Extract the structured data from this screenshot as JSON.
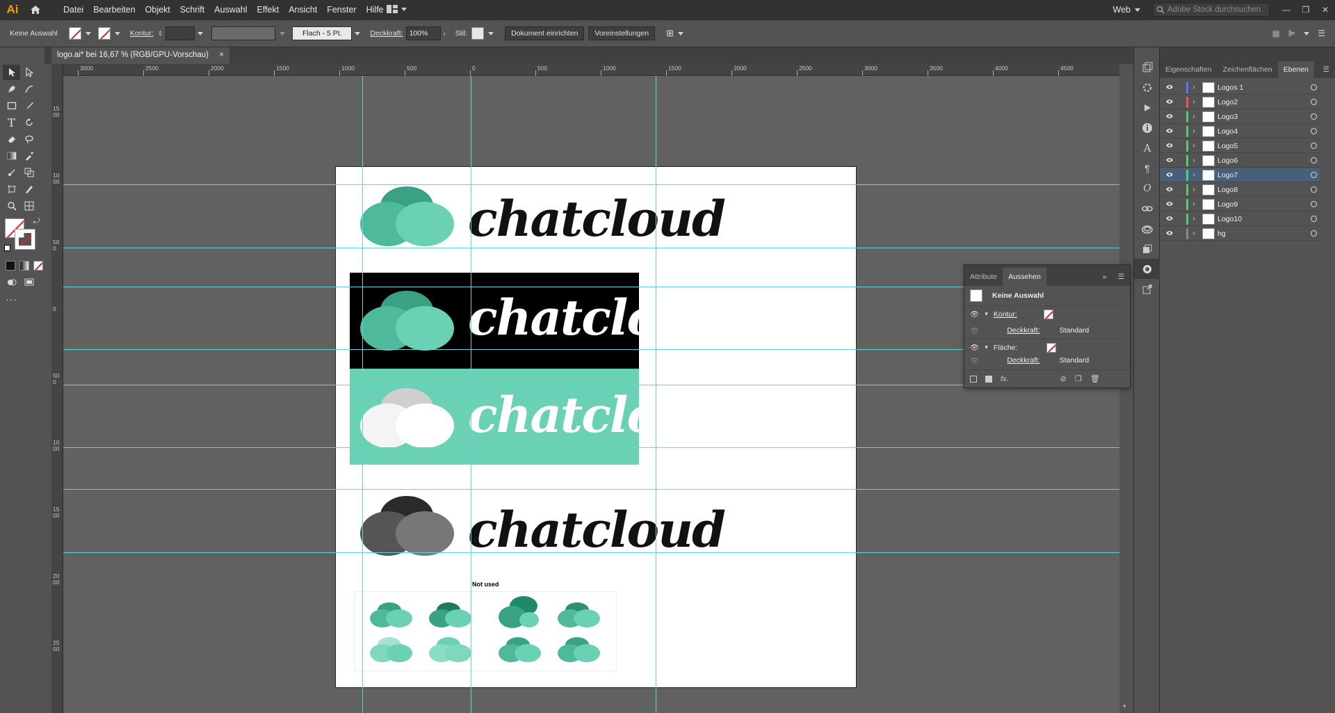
{
  "app": {
    "logo_text": "Ai"
  },
  "menu": [
    "Datei",
    "Bearbeiten",
    "Objekt",
    "Schrift",
    "Auswahl",
    "Effekt",
    "Ansicht",
    "Fenster",
    "Hilfe"
  ],
  "workspace": {
    "name": "Web"
  },
  "search": {
    "placeholder": "Adobe Stock durchsuchen"
  },
  "control_bar": {
    "selection_label": "Keine Auswahl",
    "stroke_label": "Kontur:",
    "brush_label": "Flach - 5 Pt.",
    "opacity_label": "Deckkraft:",
    "opacity_value": "100%",
    "style_label": "Stil:",
    "doc_setup_button": "Dokument einrichten",
    "preferences_button": "Voreinstellungen"
  },
  "document_tab": {
    "title": "logo.ai* bei 16,67 % (RGB/GPU-Vorschau)",
    "close": "×"
  },
  "ruler": {
    "h_labels": [
      "3000",
      "2500",
      "2000",
      "1500",
      "1000",
      "500",
      "0",
      "500",
      "1000",
      "1500",
      "2000",
      "2500",
      "3000",
      "3500",
      "4000",
      "4500"
    ],
    "v_labels": [
      "1500",
      "1000",
      "500",
      "0",
      "500",
      "1000",
      "1500",
      "2000",
      "2500"
    ]
  },
  "artboard": {
    "wordmark": "chatcloud",
    "not_used_label": "Not used",
    "colors": {
      "teal": "#6ad1b4",
      "dark_teal": "#3aa184",
      "black": "#000000",
      "gray": "#555555"
    }
  },
  "layers_panel": {
    "tabs": [
      "Eigenschaften",
      "Zeichenflächen",
      "Ebenen"
    ],
    "active_tab": "Ebenen",
    "layers": [
      {
        "name": "Logos 1",
        "color": "#4f7bff"
      },
      {
        "name": "Logo2",
        "color": "#ff4f4f"
      },
      {
        "name": "Logo3",
        "color": "#4fd16a"
      },
      {
        "name": "Logo4",
        "color": "#4fd16a"
      },
      {
        "name": "Logo5",
        "color": "#4fd16a"
      },
      {
        "name": "Logo6",
        "color": "#4fd16a"
      },
      {
        "name": "Logo7",
        "color": "#4fd16a",
        "selected": true
      },
      {
        "name": "Logo8",
        "color": "#4fd16a"
      },
      {
        "name": "Logo9",
        "color": "#4fd16a"
      },
      {
        "name": "Logo10",
        "color": "#4fd16a"
      },
      {
        "name": "hg",
        "color": "#888888"
      }
    ]
  },
  "appearance_panel": {
    "tabs": [
      "Attribute",
      "Aussehen"
    ],
    "active_tab": "Aussehen",
    "header": "Keine Auswahl",
    "stroke_label": "Kontur:",
    "opacity_label": "Deckkraft:",
    "opacity_value": "Standard",
    "fill_label": "Fläche:",
    "opacity2_label": "Deckkraft:",
    "opacity2_value": "Standard",
    "fx_label": "fx."
  }
}
